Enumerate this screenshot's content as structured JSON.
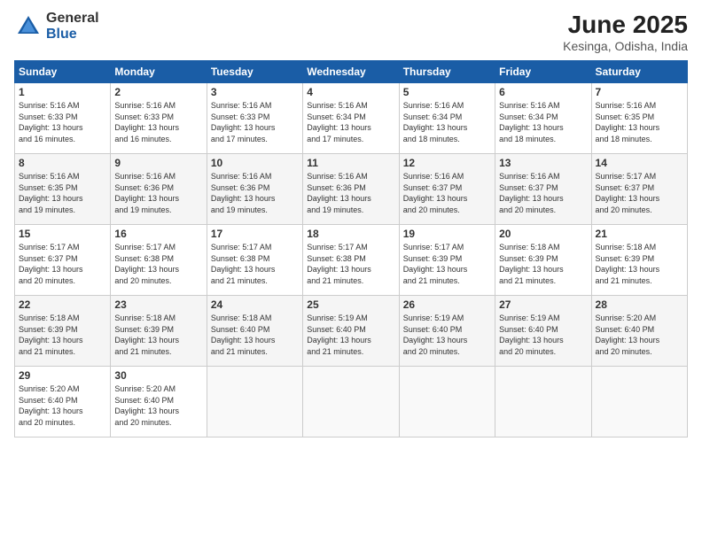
{
  "logo": {
    "general": "General",
    "blue": "Blue"
  },
  "title": "June 2025",
  "subtitle": "Kesinga, Odisha, India",
  "days_header": [
    "Sunday",
    "Monday",
    "Tuesday",
    "Wednesday",
    "Thursday",
    "Friday",
    "Saturday"
  ],
  "weeks": [
    [
      {
        "day": "1",
        "info": "Sunrise: 5:16 AM\nSunset: 6:33 PM\nDaylight: 13 hours\nand 16 minutes."
      },
      {
        "day": "2",
        "info": "Sunrise: 5:16 AM\nSunset: 6:33 PM\nDaylight: 13 hours\nand 16 minutes."
      },
      {
        "day": "3",
        "info": "Sunrise: 5:16 AM\nSunset: 6:33 PM\nDaylight: 13 hours\nand 17 minutes."
      },
      {
        "day": "4",
        "info": "Sunrise: 5:16 AM\nSunset: 6:34 PM\nDaylight: 13 hours\nand 17 minutes."
      },
      {
        "day": "5",
        "info": "Sunrise: 5:16 AM\nSunset: 6:34 PM\nDaylight: 13 hours\nand 18 minutes."
      },
      {
        "day": "6",
        "info": "Sunrise: 5:16 AM\nSunset: 6:34 PM\nDaylight: 13 hours\nand 18 minutes."
      },
      {
        "day": "7",
        "info": "Sunrise: 5:16 AM\nSunset: 6:35 PM\nDaylight: 13 hours\nand 18 minutes."
      }
    ],
    [
      {
        "day": "8",
        "info": "Sunrise: 5:16 AM\nSunset: 6:35 PM\nDaylight: 13 hours\nand 19 minutes."
      },
      {
        "day": "9",
        "info": "Sunrise: 5:16 AM\nSunset: 6:36 PM\nDaylight: 13 hours\nand 19 minutes."
      },
      {
        "day": "10",
        "info": "Sunrise: 5:16 AM\nSunset: 6:36 PM\nDaylight: 13 hours\nand 19 minutes."
      },
      {
        "day": "11",
        "info": "Sunrise: 5:16 AM\nSunset: 6:36 PM\nDaylight: 13 hours\nand 19 minutes."
      },
      {
        "day": "12",
        "info": "Sunrise: 5:16 AM\nSunset: 6:37 PM\nDaylight: 13 hours\nand 20 minutes."
      },
      {
        "day": "13",
        "info": "Sunrise: 5:16 AM\nSunset: 6:37 PM\nDaylight: 13 hours\nand 20 minutes."
      },
      {
        "day": "14",
        "info": "Sunrise: 5:17 AM\nSunset: 6:37 PM\nDaylight: 13 hours\nand 20 minutes."
      }
    ],
    [
      {
        "day": "15",
        "info": "Sunrise: 5:17 AM\nSunset: 6:37 PM\nDaylight: 13 hours\nand 20 minutes."
      },
      {
        "day": "16",
        "info": "Sunrise: 5:17 AM\nSunset: 6:38 PM\nDaylight: 13 hours\nand 20 minutes."
      },
      {
        "day": "17",
        "info": "Sunrise: 5:17 AM\nSunset: 6:38 PM\nDaylight: 13 hours\nand 21 minutes."
      },
      {
        "day": "18",
        "info": "Sunrise: 5:17 AM\nSunset: 6:38 PM\nDaylight: 13 hours\nand 21 minutes."
      },
      {
        "day": "19",
        "info": "Sunrise: 5:17 AM\nSunset: 6:39 PM\nDaylight: 13 hours\nand 21 minutes."
      },
      {
        "day": "20",
        "info": "Sunrise: 5:18 AM\nSunset: 6:39 PM\nDaylight: 13 hours\nand 21 minutes."
      },
      {
        "day": "21",
        "info": "Sunrise: 5:18 AM\nSunset: 6:39 PM\nDaylight: 13 hours\nand 21 minutes."
      }
    ],
    [
      {
        "day": "22",
        "info": "Sunrise: 5:18 AM\nSunset: 6:39 PM\nDaylight: 13 hours\nand 21 minutes."
      },
      {
        "day": "23",
        "info": "Sunrise: 5:18 AM\nSunset: 6:39 PM\nDaylight: 13 hours\nand 21 minutes."
      },
      {
        "day": "24",
        "info": "Sunrise: 5:18 AM\nSunset: 6:40 PM\nDaylight: 13 hours\nand 21 minutes."
      },
      {
        "day": "25",
        "info": "Sunrise: 5:19 AM\nSunset: 6:40 PM\nDaylight: 13 hours\nand 21 minutes."
      },
      {
        "day": "26",
        "info": "Sunrise: 5:19 AM\nSunset: 6:40 PM\nDaylight: 13 hours\nand 20 minutes."
      },
      {
        "day": "27",
        "info": "Sunrise: 5:19 AM\nSunset: 6:40 PM\nDaylight: 13 hours\nand 20 minutes."
      },
      {
        "day": "28",
        "info": "Sunrise: 5:20 AM\nSunset: 6:40 PM\nDaylight: 13 hours\nand 20 minutes."
      }
    ],
    [
      {
        "day": "29",
        "info": "Sunrise: 5:20 AM\nSunset: 6:40 PM\nDaylight: 13 hours\nand 20 minutes."
      },
      {
        "day": "30",
        "info": "Sunrise: 5:20 AM\nSunset: 6:40 PM\nDaylight: 13 hours\nand 20 minutes."
      },
      {
        "day": "",
        "info": ""
      },
      {
        "day": "",
        "info": ""
      },
      {
        "day": "",
        "info": ""
      },
      {
        "day": "",
        "info": ""
      },
      {
        "day": "",
        "info": ""
      }
    ]
  ]
}
